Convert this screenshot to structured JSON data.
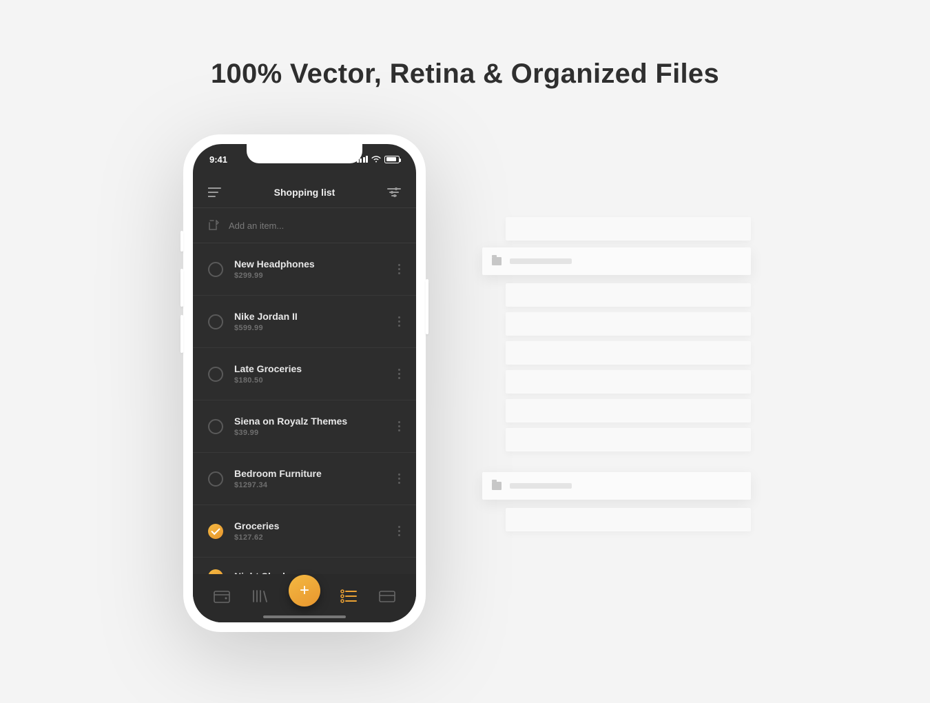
{
  "headline": "100% Vector, Retina & Organized Files",
  "status": {
    "time": "9:41"
  },
  "header": {
    "title": "Shopping list"
  },
  "add": {
    "placeholder": "Add an item..."
  },
  "items": [
    {
      "title": "New Headphones",
      "price": "$299.99",
      "done": false
    },
    {
      "title": "Nike Jordan II",
      "price": "$599.99",
      "done": false
    },
    {
      "title": "Late Groceries",
      "price": "$180.50",
      "done": false
    },
    {
      "title": "Siena on Royalz Themes",
      "price": "$39.99",
      "done": false
    },
    {
      "title": "Bedroom Furniture",
      "price": "$1297.34",
      "done": false
    },
    {
      "title": "Groceries",
      "price": "$127.62",
      "done": true
    },
    {
      "title": "Night Shades",
      "price": "",
      "done": true
    }
  ],
  "fab": {
    "label": "+"
  },
  "colors": {
    "accent": "#eca234",
    "bg_dark": "#2d2d2d"
  }
}
